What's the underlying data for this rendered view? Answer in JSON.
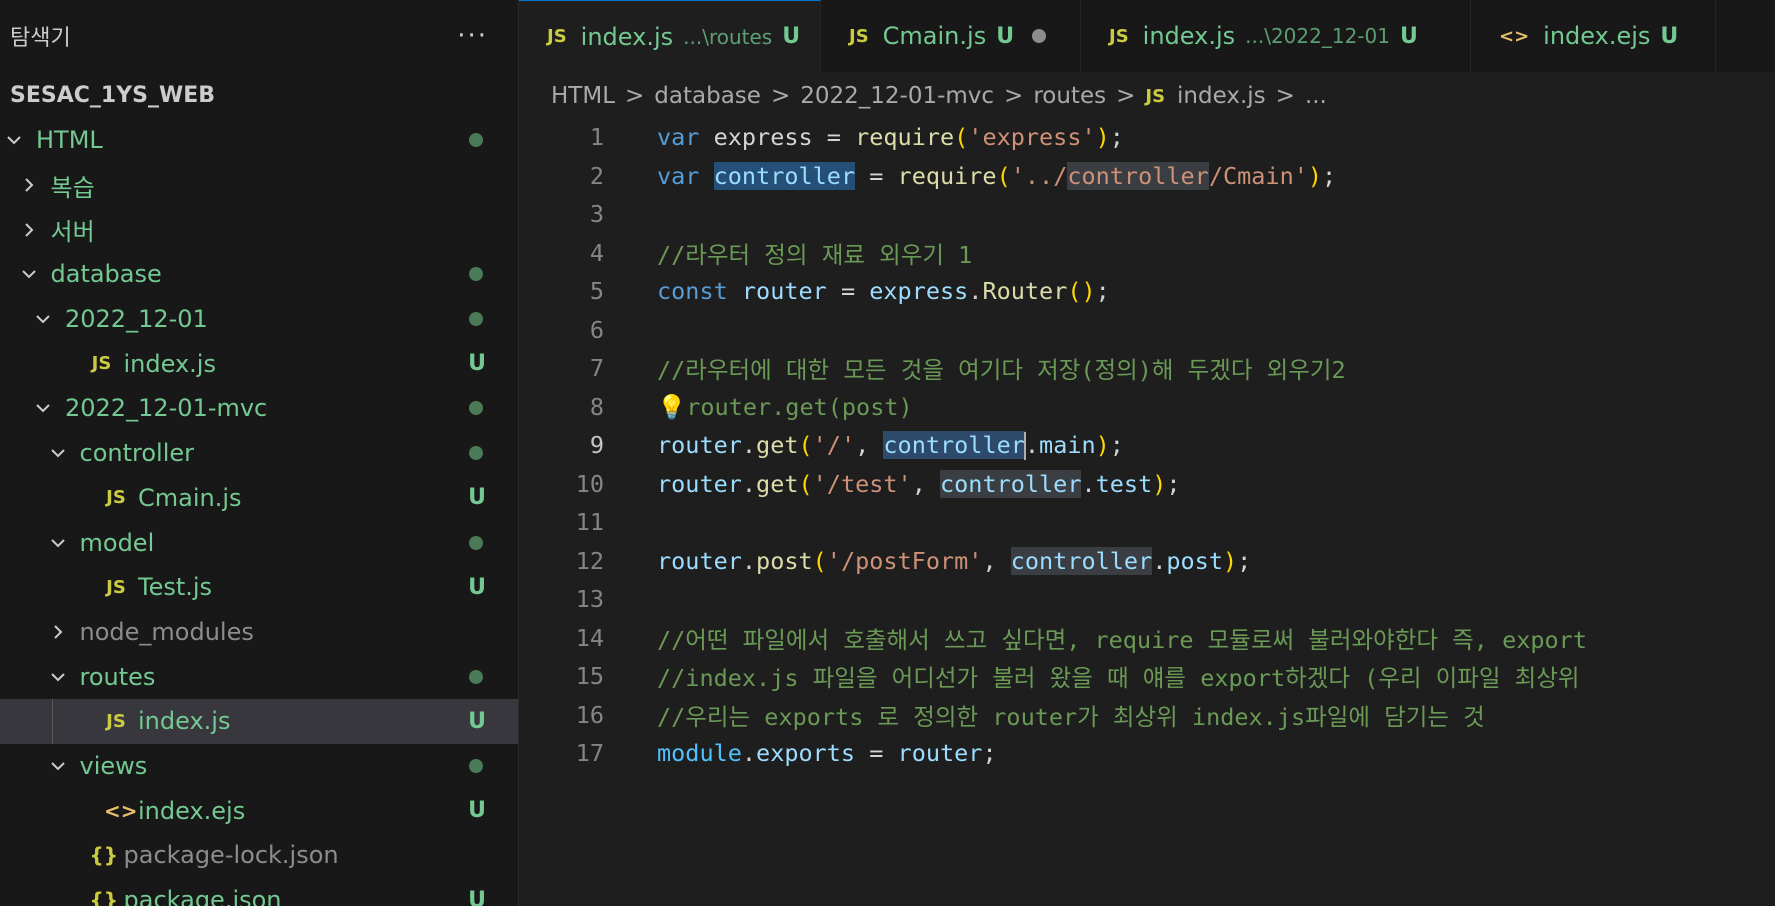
{
  "explorer": {
    "title": "탐색기",
    "more_icon": "ellipsis-icon",
    "root": "SESAC_1YS_WEB",
    "items": [
      {
        "label": "HTML",
        "indent": 0,
        "type": "folder-open",
        "status": "dot"
      },
      {
        "label": "복습",
        "indent": 1,
        "type": "folder-closed",
        "status": ""
      },
      {
        "label": "서버",
        "indent": 1,
        "type": "folder-closed",
        "status": ""
      },
      {
        "label": "database",
        "indent": 1,
        "type": "folder-open",
        "status": "dot"
      },
      {
        "label": "2022_12-01",
        "indent": 2,
        "type": "folder-open",
        "status": "dot"
      },
      {
        "label": "index.js",
        "indent": 3,
        "type": "js",
        "status": "U"
      },
      {
        "label": "2022_12-01-mvc",
        "indent": 2,
        "type": "folder-open",
        "status": "dot"
      },
      {
        "label": "controller",
        "indent": 3,
        "type": "folder-open",
        "status": "dot"
      },
      {
        "label": "Cmain.js",
        "indent": 4,
        "type": "js",
        "status": "U"
      },
      {
        "label": "model",
        "indent": 3,
        "type": "folder-open",
        "status": "dot"
      },
      {
        "label": "Test.js",
        "indent": 4,
        "type": "js",
        "status": "U"
      },
      {
        "label": "node_modules",
        "indent": 3,
        "type": "folder-closed",
        "status": "",
        "muted": true
      },
      {
        "label": "routes",
        "indent": 3,
        "type": "folder-open",
        "status": "dot"
      },
      {
        "label": "index.js",
        "indent": 4,
        "type": "js",
        "status": "U",
        "selected": true
      },
      {
        "label": "views",
        "indent": 3,
        "type": "folder-open",
        "status": "dot"
      },
      {
        "label": "index.ejs",
        "indent": 4,
        "type": "ejs",
        "status": "U"
      },
      {
        "label": "package-lock.json",
        "indent": 3,
        "type": "json",
        "status": "",
        "muted": true
      },
      {
        "label": "package.json",
        "indent": 3,
        "type": "json",
        "status": "U"
      }
    ]
  },
  "tabs": [
    {
      "icon": "JS",
      "name": "index.js",
      "desc": "...\\routes",
      "status": "U",
      "dot": "#ffffff",
      "active": true
    },
    {
      "icon": "JS",
      "name": "Cmain.js",
      "desc": "",
      "status": "U",
      "dot": "#8c8c8c",
      "active": false
    },
    {
      "icon": "JS",
      "name": "index.js",
      "desc": "...\\2022_12-01",
      "status": "U",
      "dot": "",
      "active": false
    },
    {
      "icon": "<>",
      "name": "index.ejs",
      "desc": "",
      "status": "U",
      "dot": "",
      "active": false
    }
  ],
  "breadcrumb": {
    "items": [
      "HTML",
      "database",
      "2022_12-01-mvc",
      "routes"
    ],
    "file_icon": "JS",
    "file": "index.js",
    "tail": "..."
  },
  "editor": {
    "current_line": 9,
    "lines": [
      [
        [
          "k",
          "var"
        ],
        [
          "p",
          " express = "
        ],
        [
          "f",
          "require"
        ],
        [
          "g",
          "("
        ],
        [
          "s",
          "'express'"
        ],
        [
          "g",
          ")"
        ],
        [
          "p",
          ";"
        ]
      ],
      [
        [
          "k",
          "var"
        ],
        [
          "p",
          " "
        ],
        [
          "v",
          "controller",
          "sel"
        ],
        [
          "p",
          " = "
        ],
        [
          "f",
          "require"
        ],
        [
          "g",
          "("
        ],
        [
          "s",
          "'../"
        ],
        [
          "s",
          "controller",
          "occ"
        ],
        [
          "s",
          "/Cmain'"
        ],
        [
          "g",
          ")"
        ],
        [
          "p",
          ";"
        ]
      ],
      [],
      [
        [
          "c",
          "//라우터 정의 재료 외우기 1"
        ]
      ],
      [
        [
          "k",
          "const"
        ],
        [
          "p",
          " "
        ],
        [
          "v",
          "router"
        ],
        [
          "p",
          " = "
        ],
        [
          "v",
          "express"
        ],
        [
          "p",
          "."
        ],
        [
          "f",
          "Router"
        ],
        [
          "g",
          "()"
        ],
        [
          "p",
          ";"
        ]
      ],
      [],
      [
        [
          "c",
          "//라우터에 대한 모든 것을 여기다 저장(정의)해 두겠다 외우기2"
        ]
      ],
      [
        [
          "bulb",
          "💡"
        ],
        [
          "c",
          "router.get(post)"
        ]
      ],
      [
        [
          "v",
          "router"
        ],
        [
          "p",
          "."
        ],
        [
          "f",
          "get"
        ],
        [
          "g",
          "("
        ],
        [
          "s",
          "'/'"
        ],
        [
          "p",
          ", "
        ],
        [
          "v",
          "controller",
          "cur"
        ],
        [
          "caret",
          ""
        ],
        [
          "p",
          "."
        ],
        [
          "v",
          "main"
        ],
        [
          "g",
          ")"
        ],
        [
          "p",
          ";"
        ]
      ],
      [
        [
          "v",
          "router"
        ],
        [
          "p",
          "."
        ],
        [
          "f",
          "get"
        ],
        [
          "g",
          "("
        ],
        [
          "s",
          "'/test'"
        ],
        [
          "p",
          ", "
        ],
        [
          "v",
          "controller",
          "occ"
        ],
        [
          "p",
          "."
        ],
        [
          "v",
          "test"
        ],
        [
          "g",
          ")"
        ],
        [
          "p",
          ";"
        ]
      ],
      [],
      [
        [
          "v",
          "router"
        ],
        [
          "p",
          "."
        ],
        [
          "f",
          "post"
        ],
        [
          "g",
          "("
        ],
        [
          "s",
          "'/postForm'"
        ],
        [
          "p",
          ", "
        ],
        [
          "v",
          "controller",
          "occ"
        ],
        [
          "p",
          "."
        ],
        [
          "v",
          "post"
        ],
        [
          "g",
          ")"
        ],
        [
          "p",
          ";"
        ]
      ],
      [],
      [
        [
          "c",
          "//어떤 파일에서 호출해서 쓰고 싶다면, require 모듈로써 불러와야한다 즉, export"
        ]
      ],
      [
        [
          "c",
          "//index.js 파일을 어디선가 불러 왔을 때 얘를 export하겠다 (우리 이파일 최상위"
        ]
      ],
      [
        [
          "c",
          "//우리는 exports 로 정의한 router가 최상위 index.js파일에 담기는 것"
        ]
      ],
      [
        [
          "mod",
          "module"
        ],
        [
          "p",
          "."
        ],
        [
          "v",
          "exports"
        ],
        [
          "p",
          " = "
        ],
        [
          "v",
          "router"
        ],
        [
          "p",
          ";"
        ]
      ]
    ]
  }
}
